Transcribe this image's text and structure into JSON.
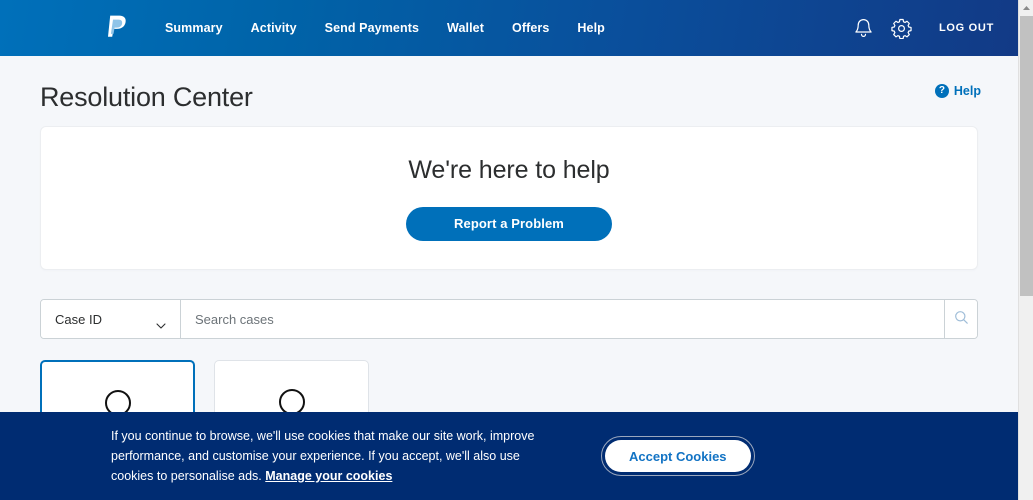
{
  "navbar": {
    "logo_name": "paypal-logo",
    "links": [
      {
        "label": "Summary"
      },
      {
        "label": "Activity"
      },
      {
        "label": "Send Payments"
      },
      {
        "label": "Wallet"
      },
      {
        "label": "Offers"
      },
      {
        "label": "Help"
      }
    ],
    "notifications_icon": "bell-icon",
    "settings_icon": "gear-icon",
    "logout_label": "LOG OUT",
    "gradient_start": "#0070ba",
    "gradient_end": "#123a86",
    "text_color": "#ffffff"
  },
  "header": {
    "title": "Resolution Center",
    "help_badge": "?",
    "help_label": "Help",
    "help_color": "#0070ba"
  },
  "hero": {
    "title": "We're here to help",
    "button_label": "Report a Problem",
    "button_color": "#0070ba"
  },
  "search": {
    "select_value": "Case ID",
    "placeholder": "Search cases",
    "value": "",
    "search_icon": "magnifier-icon",
    "chevron_icon": "chevron-down-icon"
  },
  "filters": {
    "cards": [
      {
        "name": "filter-card-1",
        "selected": true
      },
      {
        "name": "filter-card-2",
        "selected": false
      }
    ],
    "selected_border_color": "#0070ba"
  },
  "cookie_banner": {
    "text_part1": "If you continue to browse, we'll use cookies that make our site work, improve performance, and customise your experience. If you accept, we'll also use cookies to personalise ads. ",
    "link_label": "Manage your cookies",
    "accept_label": "Accept Cookies",
    "background": "#002c72",
    "accept_text_color": "#1273c4"
  },
  "scrollbar": {
    "up_arrow_icon": "scroll-up-arrow-icon"
  }
}
